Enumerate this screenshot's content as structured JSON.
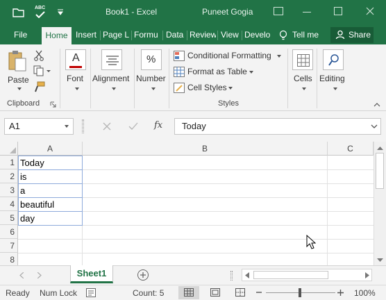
{
  "title_bar": {
    "doc_title": "Book1 - Excel",
    "user_name": "Puneet Gogia"
  },
  "tabs": [
    "File",
    "Home",
    "Insert",
    "Page L",
    "Formu",
    "Data",
    "Review",
    "View",
    "Develo"
  ],
  "active_tab": "Home",
  "tell_me": "Tell me",
  "share": "Share",
  "ribbon": {
    "clipboard": {
      "paste": "Paste",
      "group": "Clipboard"
    },
    "font": {
      "label": "Font"
    },
    "alignment": {
      "label": "Alignment"
    },
    "number": {
      "label": "Number"
    },
    "styles": {
      "conditional": "Conditional Formatting",
      "format_table": "Format as Table",
      "cell_styles": "Cell Styles",
      "group": "Styles"
    },
    "cells": {
      "label": "Cells"
    },
    "editing": {
      "label": "Editing"
    }
  },
  "formula_bar": {
    "name_box": "A1",
    "fx": "fx",
    "value": "Today"
  },
  "columns": [
    "A",
    "B",
    "C"
  ],
  "rows": [
    "1",
    "2",
    "3",
    "4",
    "5",
    "6",
    "7",
    "8"
  ],
  "cells_A": [
    "Today",
    "is",
    "a",
    "beautiful",
    "day",
    "",
    "",
    ""
  ],
  "sheet_tab": "Sheet1",
  "status": {
    "ready": "Ready",
    "numlock": "Num Lock",
    "count": "Count: 5",
    "zoom": "100%"
  },
  "colors": {
    "accent": "#217346",
    "ribbon": "#f3f3f3",
    "cell_border": "#8eaadb"
  }
}
